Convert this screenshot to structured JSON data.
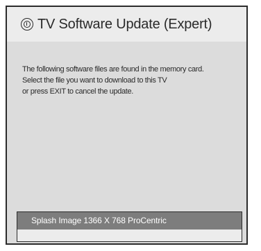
{
  "dialog": {
    "title": "TV Software Update (Expert)",
    "icon": "info-circle-icon",
    "message_lines": [
      "The following software files are found in the memory card.",
      "Select the file you want to download to this TV",
      "or press EXIT to cancel the update."
    ],
    "files": [
      {
        "label": "Splash Image 1366 X 768 ProCentric",
        "selected": true
      }
    ]
  },
  "colors": {
    "header_background": "#ececec",
    "body_background": "#dcdcdc",
    "selected_item_background": "#7d7d7d",
    "border": "#2b2b2b"
  }
}
